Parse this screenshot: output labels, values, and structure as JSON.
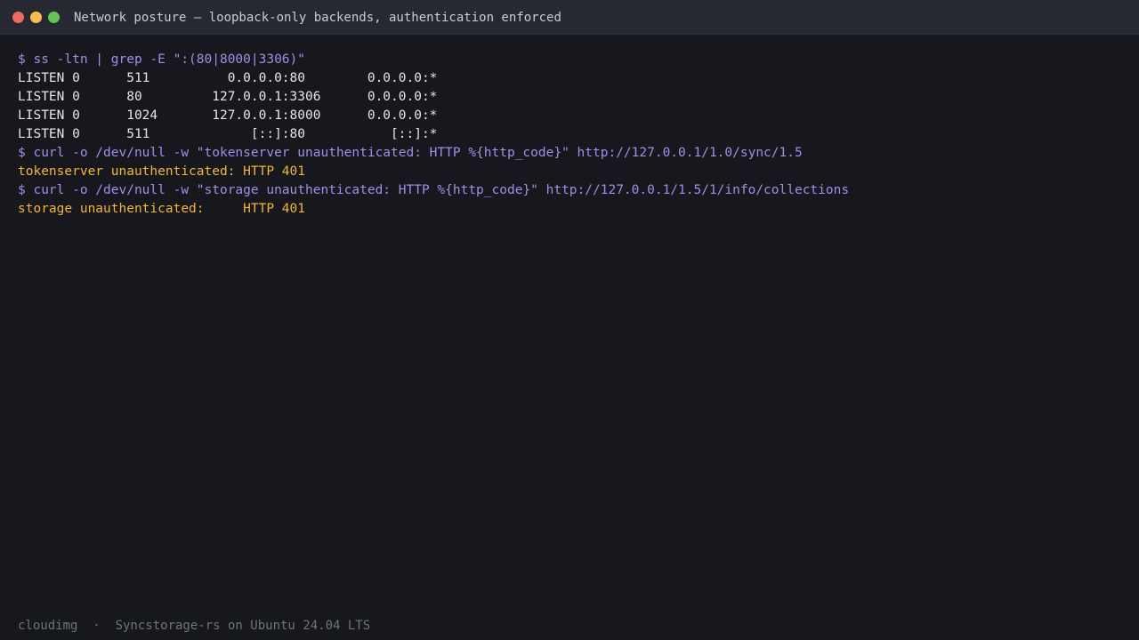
{
  "window": {
    "title": "Network posture — loopback-only backends, authentication enforced"
  },
  "terminal": {
    "lines": [
      {
        "kind": "cmd",
        "text": "$ ss -ltn | grep -E \":(80|8000|3306)\""
      },
      {
        "kind": "plain",
        "text": "LISTEN 0      511          0.0.0.0:80        0.0.0.0:*"
      },
      {
        "kind": "plain",
        "text": "LISTEN 0      80         127.0.0.1:3306      0.0.0.0:*"
      },
      {
        "kind": "plain",
        "text": "LISTEN 0      1024       127.0.0.1:8000      0.0.0.0:*"
      },
      {
        "kind": "plain",
        "text": "LISTEN 0      511             [::]:80           [::]:*"
      },
      {
        "kind": "cmd",
        "text": "$ curl -o /dev/null -w \"tokenserver unauthenticated: HTTP %{http_code}\" http://127.0.0.1/1.0/sync/1.5"
      },
      {
        "kind": "warn",
        "text": "tokenserver unauthenticated: HTTP 401"
      },
      {
        "kind": "cmd",
        "text": "$ curl -o /dev/null -w \"storage unauthenticated: HTTP %{http_code}\" http://127.0.0.1/1.5/1/info/collections"
      },
      {
        "kind": "warn",
        "text": "storage unauthenticated:     HTTP 401"
      }
    ]
  },
  "footer": {
    "text": "cloudimg  ·  Syncstorage-rs on Ubuntu 24.04 LTS"
  },
  "colors": {
    "background": "#17181d",
    "titlebar": "#262931",
    "command": "#a08ee8",
    "output": "#e4e6ea",
    "status": "#f2b53a",
    "footer": "#6f737b"
  }
}
